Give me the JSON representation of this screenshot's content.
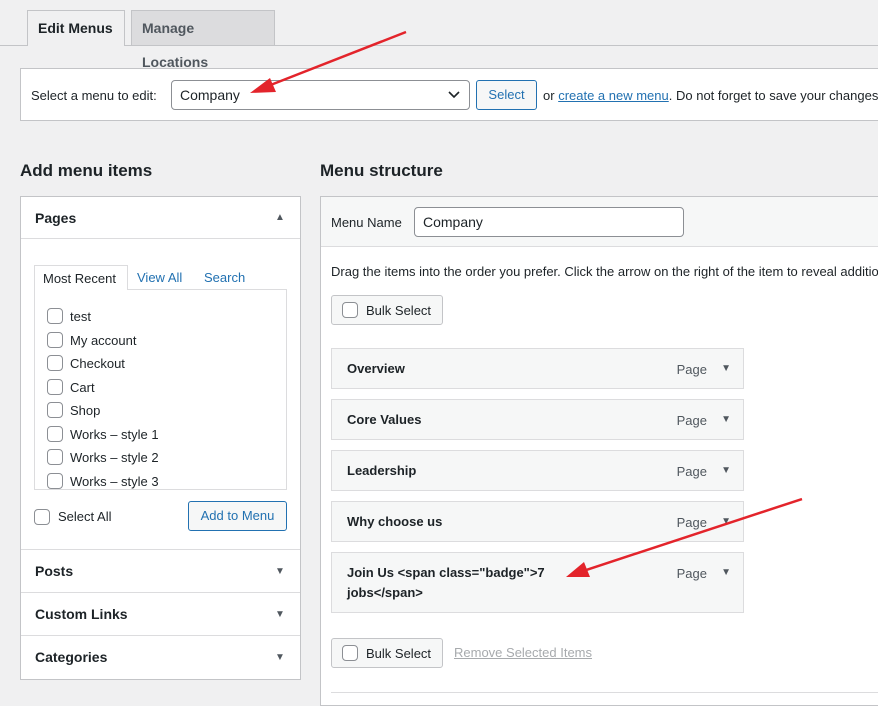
{
  "tabs": {
    "edit_menus": "Edit Menus",
    "manage_locations": "Manage Locations"
  },
  "manage": {
    "label": "Select a menu to edit:",
    "selected_menu": "Company",
    "select_button": "Select",
    "or_text": "or",
    "create_link": "create a new menu",
    "hint": ". Do not forget to save your changes!"
  },
  "left": {
    "heading": "Add menu items",
    "pages": {
      "title": "Pages",
      "tabs": [
        "Most Recent",
        "View All",
        "Search"
      ],
      "items": [
        "test",
        "My account",
        "Checkout",
        "Cart",
        "Shop",
        "Works – style 1",
        "Works – style 2",
        "Works – style 3"
      ],
      "select_all": "Select All",
      "add_button": "Add to Menu"
    },
    "sections": [
      "Posts",
      "Custom Links",
      "Categories"
    ]
  },
  "right": {
    "heading": "Menu structure",
    "menu_name_label": "Menu Name",
    "menu_name_value": "Company",
    "instructions": "Drag the items into the order you prefer. Click the arrow on the right of the item to reveal additional configuration options.",
    "bulk_select": "Bulk Select",
    "items": [
      {
        "title": "Overview",
        "type": "Page"
      },
      {
        "title": "Core Values",
        "type": "Page"
      },
      {
        "title": "Leadership",
        "type": "Page"
      },
      {
        "title": "Why choose us",
        "type": "Page"
      },
      {
        "title_line1": "Join Us <span class=\"badge\">7",
        "title_line2": "jobs</span>",
        "type": "Page"
      }
    ],
    "bulk_select_bottom": "Bulk Select",
    "remove_selected": "Remove Selected Items"
  },
  "colors": {
    "accent": "#2271b1",
    "annotation_arrow": "#e3242b"
  }
}
